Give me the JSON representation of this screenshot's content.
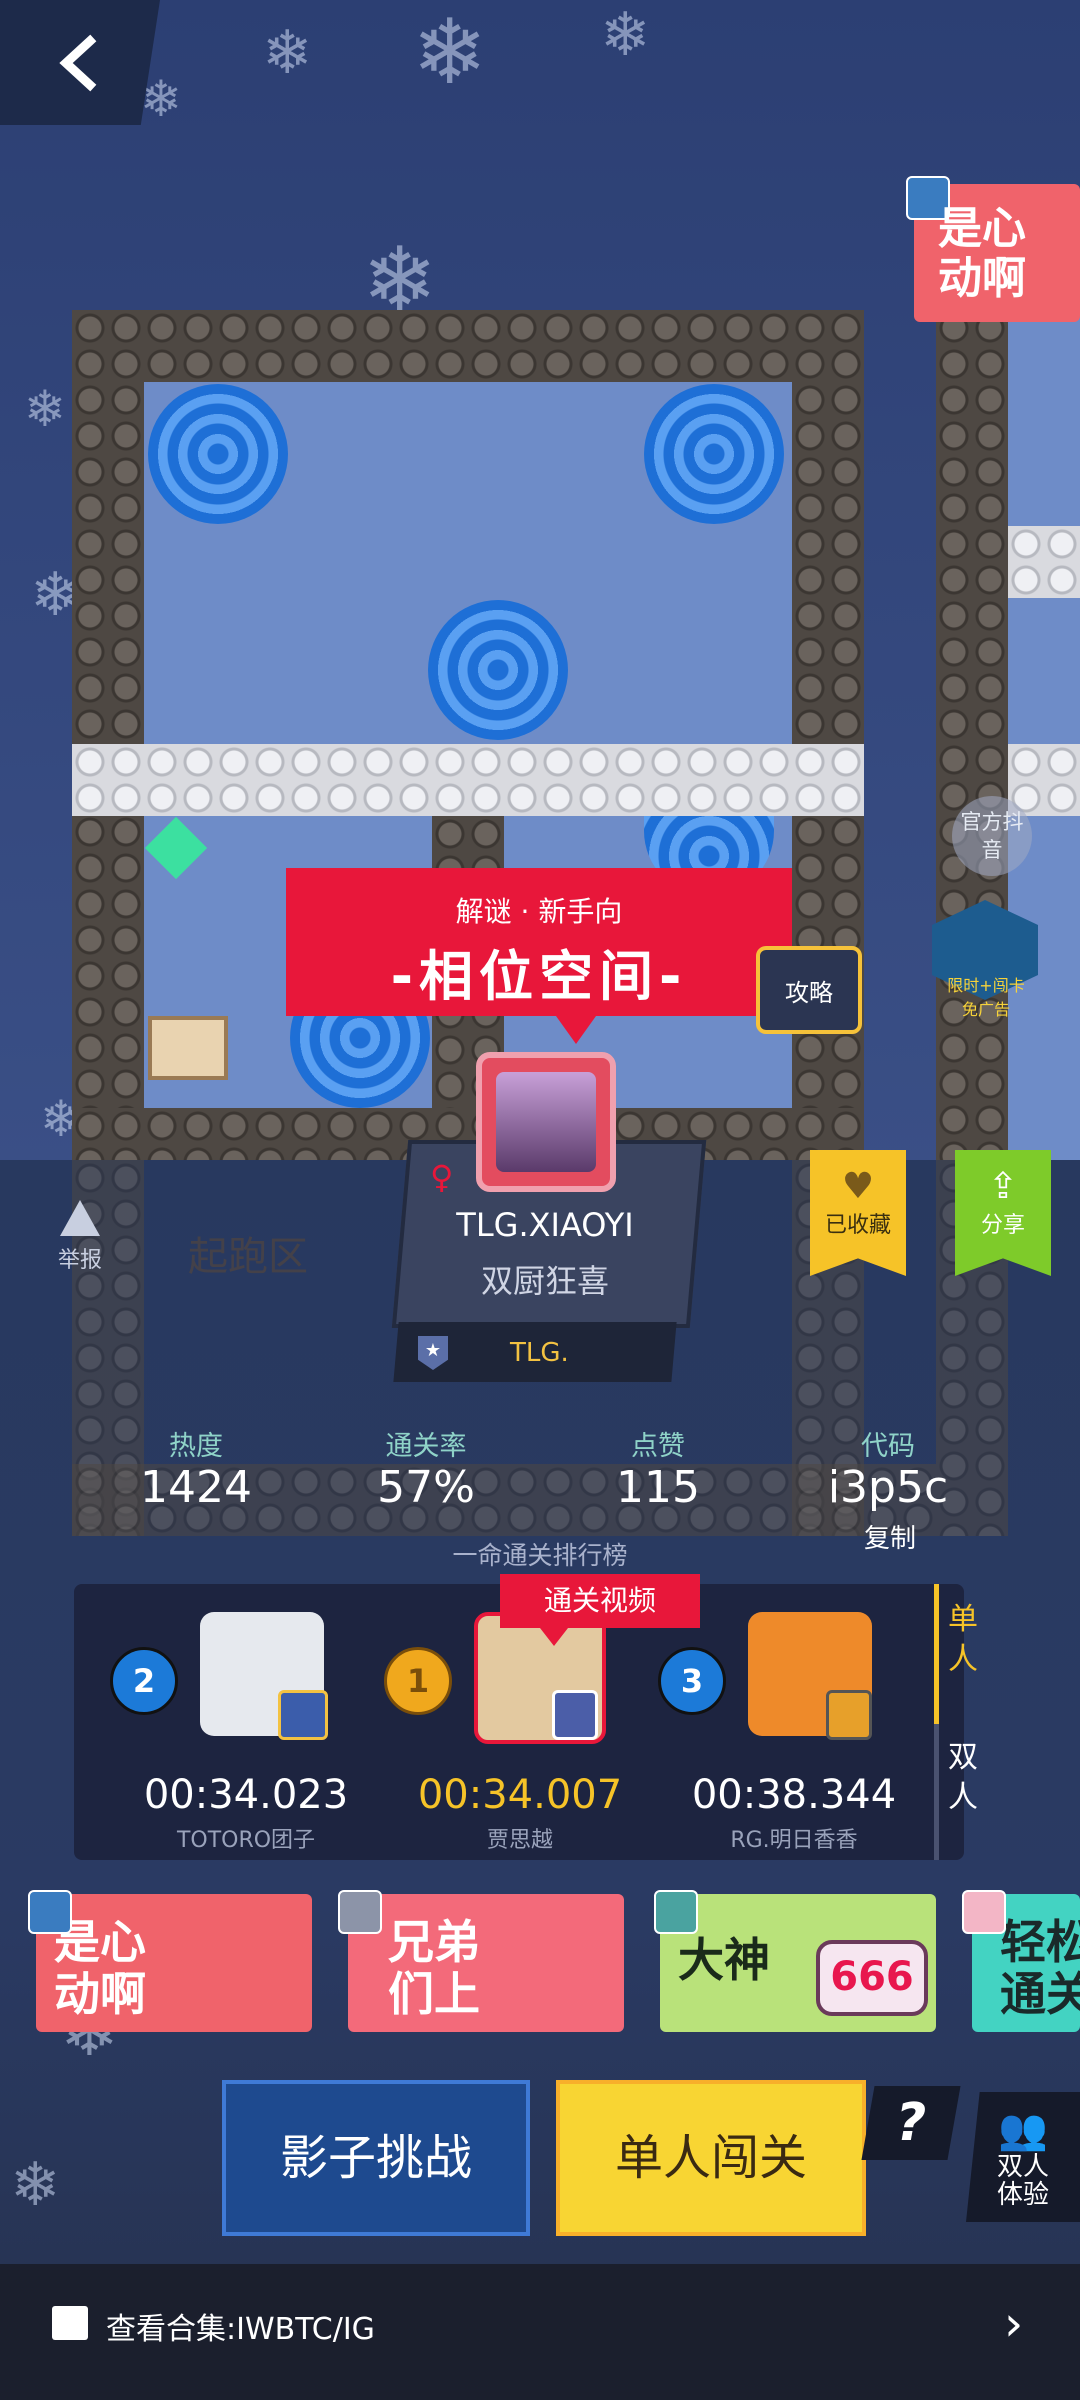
{
  "level": {
    "tags": "解谜 · 新手向",
    "title": "-相位空间-",
    "guide_label": "攻略",
    "start_zone_label": "起跑区"
  },
  "author": {
    "name": "TLG.XIAOYI",
    "title": "双厨狂喜",
    "team": "TLG.",
    "gender_symbol": "♀"
  },
  "actions": {
    "report_label": "举报",
    "favorite_label": "已收藏",
    "share_label": "分享",
    "official_label": "官方抖音",
    "ad_label": "限时+闯卡\n免广告"
  },
  "stats": {
    "heat_label": "热度",
    "heat_value": "1424",
    "pass_rate_label": "通关率",
    "pass_rate_value": "57%",
    "likes_label": "点赞",
    "likes_value": "115",
    "code_label": "代码",
    "code_value": "i3p5c",
    "copy_label": "复制"
  },
  "leaderboard": {
    "title": "一命通关排行榜",
    "video_tag": "通关视频",
    "tabs": [
      "单人",
      "双人"
    ],
    "players": [
      {
        "rank": "2",
        "time": "00:34.023",
        "name": "TOTORO团子"
      },
      {
        "rank": "1",
        "time": "00:34.007",
        "name": "贾思越"
      },
      {
        "rank": "3",
        "time": "00:38.344",
        "name": "RG.明日香香"
      }
    ]
  },
  "stickers": [
    {
      "text": "是心\n动啊",
      "color": "#f0636b"
    },
    {
      "text": "兄弟\n们上",
      "color": "#f36a7a"
    },
    {
      "text": "大神",
      "color": "#b9e27a"
    },
    {
      "text": "轻松\n通关",
      "color": "#43d3c2"
    }
  ],
  "top_sticker": {
    "text": "是心\n动啊"
  },
  "buttons": {
    "shadow": "影子挑战",
    "single": "单人闯关",
    "help": "?",
    "duo": "双人\n体验"
  },
  "collection": {
    "label": "查看合集:IWBTC/IG"
  },
  "colors": {
    "accent_red": "#e8173a",
    "gold": "#f6c328",
    "green": "#7ecb2a",
    "stat_label": "#8fd3c8"
  }
}
